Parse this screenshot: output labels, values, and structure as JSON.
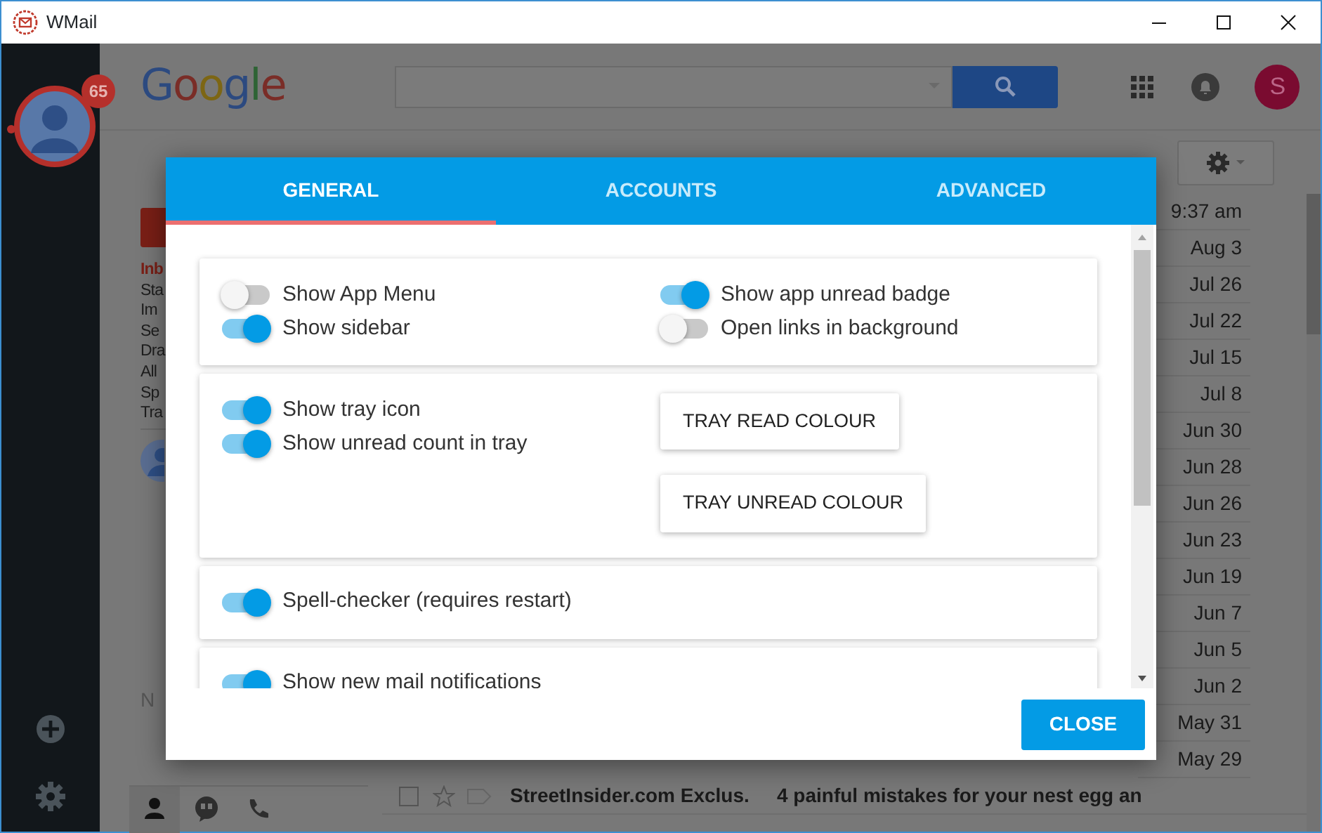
{
  "window": {
    "title": "WMail"
  },
  "account_sidebar": {
    "unread_badge": "65"
  },
  "gmail": {
    "logo": "Google",
    "avatar_letter": "S",
    "nav_labels": [
      {
        "label": "Inb",
        "selected": true
      },
      {
        "label": "Sta",
        "selected": false
      },
      {
        "label": "Im",
        "selected": false
      },
      {
        "label": "Se",
        "selected": false
      },
      {
        "label": "Dra",
        "selected": false
      },
      {
        "label": "All",
        "selected": false
      },
      {
        "label": "Sp",
        "selected": false
      },
      {
        "label": "Tra",
        "selected": false
      }
    ],
    "hangouts_text": "N",
    "rows": [
      {
        "date": "9:37 am"
      },
      {
        "date": "Aug 3"
      },
      {
        "date": "Jul 26"
      },
      {
        "date": "Jul 22"
      },
      {
        "date": "Jul 15"
      },
      {
        "date": "Jul 8"
      },
      {
        "date": "Jun 30"
      },
      {
        "date": "Jun 28"
      },
      {
        "date": "Jun 26"
      },
      {
        "date": "Jun 23"
      },
      {
        "date": "Jun 19"
      },
      {
        "date": "Jun 7"
      },
      {
        "date": "Jun 5"
      },
      {
        "date": "Jun 2"
      },
      {
        "date": "May 31"
      },
      {
        "date": "May 29"
      },
      {
        "sender": "StreetInsider.com Exclus.",
        "subject": "4 painful mistakes for your nest egg an",
        "checked": false
      }
    ]
  },
  "settings_dialog": {
    "tabs": [
      {
        "label": "GENERAL",
        "selected": true
      },
      {
        "label": "ACCOUNTS",
        "selected": false
      },
      {
        "label": "ADVANCED",
        "selected": false
      }
    ],
    "sections": [
      {
        "columns": [
          [
            {
              "kind": "toggle",
              "label": "Show App Menu",
              "on": false
            },
            {
              "kind": "toggle",
              "label": "Show sidebar",
              "on": true
            }
          ],
          [
            {
              "kind": "toggle",
              "label": "Show app unread badge",
              "on": true
            },
            {
              "kind": "toggle",
              "label": "Open links in background",
              "on": false
            }
          ]
        ]
      },
      {
        "columns": [
          [
            {
              "kind": "toggle",
              "label": "Show tray icon",
              "on": true
            },
            {
              "kind": "toggle",
              "label": "Show unread count in tray",
              "on": true
            }
          ],
          [
            {
              "kind": "button",
              "label": "TRAY READ COLOUR"
            },
            {
              "kind": "button",
              "label": "TRAY UNREAD COLOUR"
            }
          ]
        ]
      },
      {
        "columns": [
          [
            {
              "kind": "toggle",
              "label": "Spell-checker (requires restart)",
              "on": true
            }
          ]
        ]
      },
      {
        "columns": [
          [
            {
              "kind": "toggle",
              "label": "Show new mail notifications",
              "on": true
            }
          ]
        ]
      }
    ],
    "close_button": "CLOSE"
  }
}
